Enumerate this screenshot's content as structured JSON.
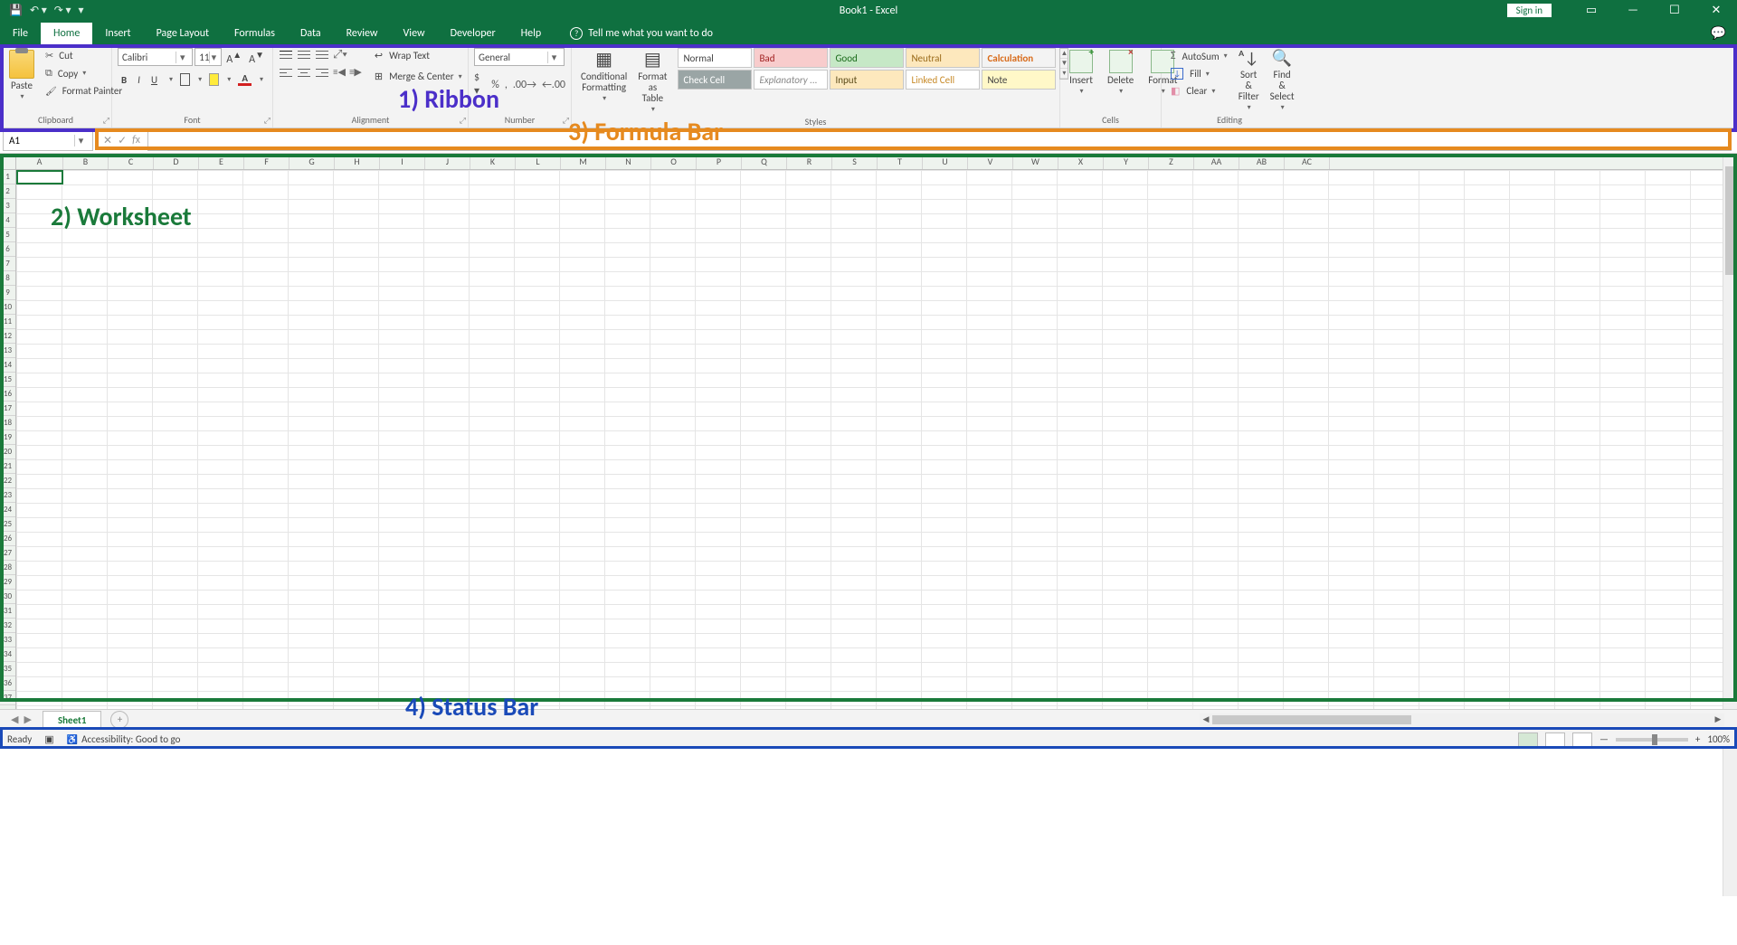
{
  "title": "Book1 - Excel",
  "signin": "Sign in",
  "tabs": [
    "File",
    "Home",
    "Insert",
    "Page Layout",
    "Formulas",
    "Data",
    "Review",
    "View",
    "Developer",
    "Help"
  ],
  "active_tab": "Home",
  "tellme": "Tell me what you want to do",
  "ribbon": {
    "clipboard": {
      "label": "Clipboard",
      "paste": "Paste",
      "cut": "Cut",
      "copy": "Copy",
      "painter": "Format Painter"
    },
    "font": {
      "label": "Font",
      "name": "Calibri",
      "size": "11",
      "b": "B",
      "i": "I",
      "u": "U"
    },
    "alignment": {
      "label": "Alignment",
      "wrap": "Wrap Text",
      "merge": "Merge & Center"
    },
    "number": {
      "label": "Number",
      "fmt": "General"
    },
    "styles": {
      "label": "Styles",
      "cond": "Conditional Formatting",
      "tbl": "Format as Table",
      "gallery": [
        "Normal",
        "Bad",
        "Good",
        "Neutral",
        "Calculation",
        "Check Cell",
        "Explanatory ...",
        "Input",
        "Linked Cell",
        "Note"
      ]
    },
    "cells": {
      "label": "Cells",
      "insert": "Insert",
      "delete": "Delete",
      "format": "Format"
    },
    "editing": {
      "label": "Editing",
      "sum": "AutoSum",
      "fill": "Fill",
      "clear": "Clear",
      "sort": "Sort & Filter",
      "find": "Find & Select"
    }
  },
  "annotations": {
    "ribbon": "1) Ribbon",
    "worksheet": "2) Worksheet",
    "formula_bar": "3) Formula Bar",
    "status_bar": "4) Status Bar"
  },
  "namebox": "A1",
  "columns": [
    "A",
    "B",
    "C",
    "D",
    "E",
    "F",
    "G",
    "H",
    "I",
    "J",
    "K",
    "L",
    "M",
    "N",
    "O",
    "P",
    "Q",
    "R",
    "S",
    "T",
    "U",
    "V",
    "W",
    "X",
    "Y",
    "Z",
    "AA",
    "AB",
    "AC"
  ],
  "row_count": 37,
  "sheet_tab": "Sheet1",
  "status": {
    "ready": "Ready",
    "accessibility": "Accessibility: Good to go",
    "zoom": "100%"
  }
}
